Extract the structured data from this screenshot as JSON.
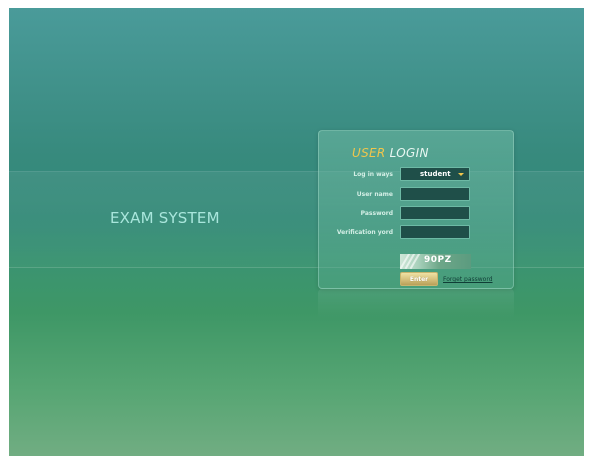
{
  "app": {
    "brand": "EXAM SYSTEM"
  },
  "login": {
    "title_accent": "USER",
    "title_rest": "LOGIN",
    "fields": {
      "login_way": {
        "label": "Log in ways",
        "value": "student"
      },
      "username": {
        "label": "User name",
        "value": ""
      },
      "password": {
        "label": "Password",
        "value": ""
      },
      "verification": {
        "label": "Verification yord",
        "value": ""
      }
    },
    "captcha_code": "90PZ",
    "enter_label": "Enter",
    "forgot_label": "Forget password"
  },
  "colors": {
    "title_accent": "#f0c64c",
    "field_bg": "#1f4f49",
    "button": "#d5c07b"
  },
  "icons": {
    "dropdown": "chevron-down-icon"
  }
}
